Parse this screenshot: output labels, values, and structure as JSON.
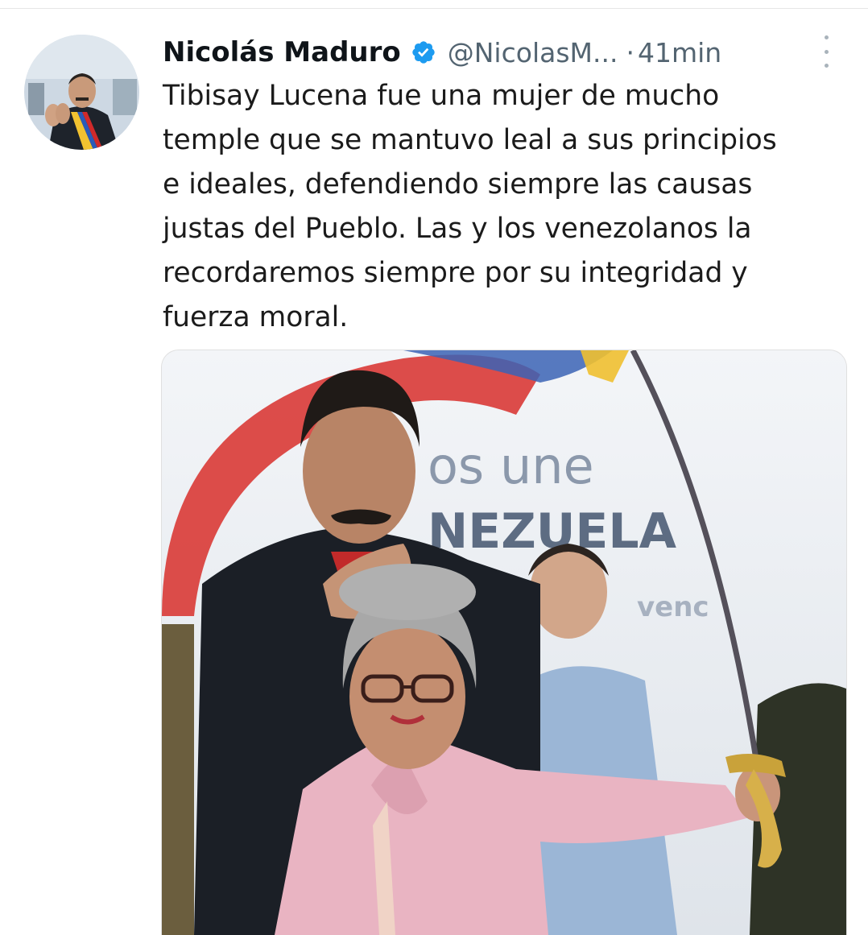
{
  "tweet": {
    "author_name": "Nicolás Maduro",
    "author_handle": "@NicolasM...",
    "separator": "·",
    "timestamp": "41min",
    "text": "Tibisay Lucena fue una mujer de mucho\ntemple que se mantuvo leal a sus principios\ne ideales, defendiendo siempre las causas\njustas del Pueblo. Las y los venezolanos la\nrecordaremos siempre por su integridad y\nfuerza moral.",
    "verified_icon": "verified-badge-icon",
    "more_icon": "more-options-icon"
  },
  "media": {
    "banner_line1": "os une",
    "banner_line2": "NEZUELA",
    "banner_line3": "venc"
  },
  "colors": {
    "text_primary": "#0f1419",
    "text_secondary": "#536471",
    "accent": "#1d9bf0"
  }
}
